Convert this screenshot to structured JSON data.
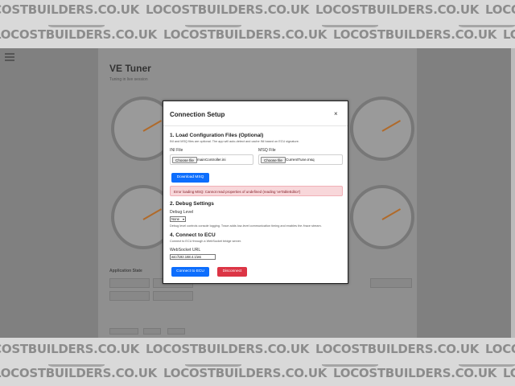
{
  "watermark": {
    "text": "LOCOSTBUILDERS.CO.UK"
  },
  "background_app": {
    "title": "VE Tuner",
    "subtitle": "Tuning in live session",
    "section_label": "Application State"
  },
  "modal": {
    "title": "Connection Setup",
    "close_label": "×",
    "section1": {
      "heading": "1. Load Configuration Files (Optional)",
      "help": "INI and MSQ files are optional. The app will auto-detect and cache INI based on ECU signature.",
      "ini_label": "INI File",
      "ini_button": "Choose file",
      "ini_file": "mainController.ini",
      "msq_label": "MSQ File",
      "msq_button": "Choose file",
      "msq_file": "CurrentTune.msq",
      "download_button": "Download MSQ",
      "error": "Error loading MSQ: Cannot read properties of undefined (reading 'veTableEditor')"
    },
    "section2": {
      "heading": "2. Debug Settings",
      "debug_label": "Debug Level",
      "debug_value": "None",
      "help": "Debug level controls console logging. Trace adds low-level communication timing and enables the /trace stream."
    },
    "section4": {
      "heading": "4. Connect to ECU",
      "help": "Connect to ECU through a WebSocket bridge server.",
      "url_label": "WebSocket URL",
      "url_value": "ws://192.168.4.1/ws",
      "connect_button": "Connect to ECU",
      "disconnect_button": "Disconnect"
    }
  },
  "colors": {
    "primary": "#0d6efd",
    "danger": "#dc3545",
    "alert_bg": "#f8d7da",
    "alert_text": "#842029"
  }
}
